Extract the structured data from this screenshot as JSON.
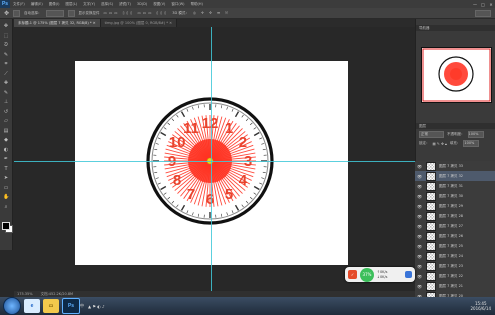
{
  "app": {
    "logo": "Ps",
    "menus": [
      "文件(F)",
      "编辑(E)",
      "图像(I)",
      "图层(L)",
      "文字(Y)",
      "选择(S)",
      "滤镜(T)",
      "3D(D)",
      "视图(V)",
      "窗口(W)",
      "帮助(H)"
    ],
    "window_controls": [
      "—",
      "□",
      "✕"
    ]
  },
  "options_bar": {
    "auto_select_label": "自动选择：",
    "show_transform_label": "显示变换控件",
    "mode_3d_label": "3D 模式："
  },
  "tabs": [
    {
      "label": "未标题-1 @ 175% (图层 7 拷贝 32, RGB/8) *",
      "active": true
    },
    {
      "label": "timg.jpg @ 100% (图层 0, RGB/8#) *",
      "active": false
    }
  ],
  "toolbar_icons": [
    "move-icon",
    "marquee-icon",
    "lasso-icon",
    "quick-select-icon",
    "crop-icon",
    "eyedropper-icon",
    "healing-icon",
    "brush-icon",
    "stamp-icon",
    "history-brush-icon",
    "eraser-icon",
    "gradient-icon",
    "blur-icon",
    "dodge-icon",
    "pen-icon",
    "type-icon",
    "path-select-icon",
    "shape-icon",
    "hand-icon",
    "zoom-icon"
  ],
  "clock_face": {
    "numerals": [
      "12",
      "1",
      "2",
      "3",
      "4",
      "5",
      "6",
      "7",
      "8",
      "9",
      "10",
      "11"
    ],
    "colors": {
      "numeral": "#e8442e",
      "sunburst": "#ff2a1a",
      "rim": "#111111",
      "center": "#f2d21a"
    }
  },
  "panels": {
    "navigator_title": "导航器",
    "layers_title": "图层",
    "blend_mode": "正常",
    "opacity_label": "不透明度：",
    "opacity_value": "100%",
    "lock_label": "锁定：",
    "fill_label": "填充：",
    "fill_value": "100%",
    "layers": [
      {
        "name": "图层 7 拷贝 33",
        "selected": false
      },
      {
        "name": "图层 7 拷贝 32",
        "selected": true
      },
      {
        "name": "图层 7 拷贝 31",
        "selected": false
      },
      {
        "name": "图层 7 拷贝 30",
        "selected": false
      },
      {
        "name": "图层 7 拷贝 29",
        "selected": false
      },
      {
        "name": "图层 7 拷贝 28",
        "selected": false
      },
      {
        "name": "图层 7 拷贝 27",
        "selected": false
      },
      {
        "name": "图层 7 拷贝 26",
        "selected": false
      },
      {
        "name": "图层 7 拷贝 25",
        "selected": false
      },
      {
        "name": "图层 7 拷贝 24",
        "selected": false
      },
      {
        "name": "图层 7 拷贝 23",
        "selected": false
      },
      {
        "name": "图层 7 拷贝 22",
        "selected": false
      },
      {
        "name": "图层 7 拷贝 21",
        "selected": false
      },
      {
        "name": "图层 7 拷贝 20",
        "selected": false
      }
    ]
  },
  "status": {
    "zoom": "175.35%",
    "doc": "文档:452.2K/20.8M"
  },
  "widget": {
    "percent": "37%",
    "up": "0K/s",
    "down": "0K/s"
  },
  "taskbar": {
    "ps_label": "Ps",
    "tray_text": "中",
    "time": "15:45",
    "date": "2016/6/14"
  }
}
